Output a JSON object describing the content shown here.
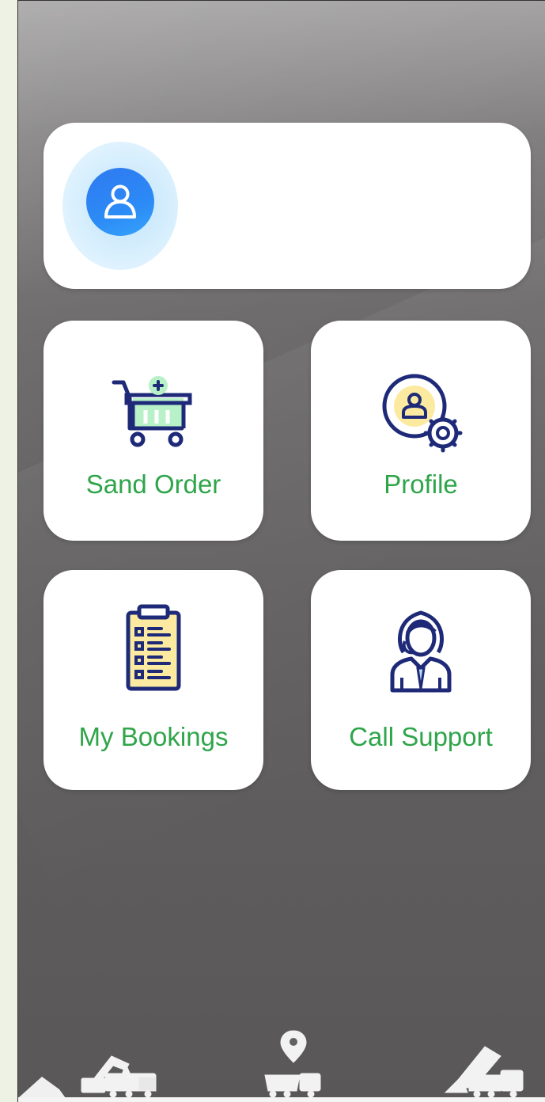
{
  "user_card": {
    "avatar_icon": "user-avatar-icon"
  },
  "tiles": [
    {
      "label": "Sand Order",
      "icon": "cart-add-icon"
    },
    {
      "label": "Profile",
      "icon": "profile-settings-icon"
    },
    {
      "label": "My Bookings",
      "icon": "clipboard-list-icon"
    },
    {
      "label": "Call Support",
      "icon": "support-agent-icon"
    }
  ],
  "footer": {
    "icons": [
      "excavator-truck-icon",
      "location-pin-truck-icon",
      "dump-truck-icon"
    ]
  },
  "colors": {
    "label_green": "#2fa54a",
    "avatar_blue": "#2c8af6",
    "icon_navy": "#1e2a78",
    "accent_yellow": "#fbeaa0",
    "accent_mint": "#b8f0c8",
    "background_grey": "#626060"
  }
}
